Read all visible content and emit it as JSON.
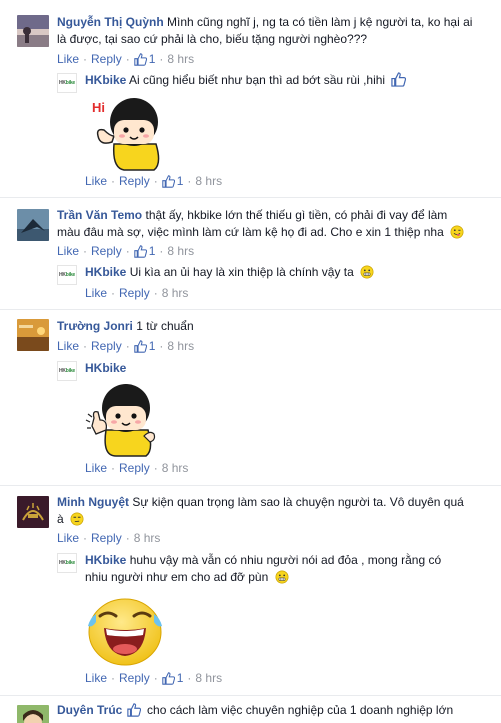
{
  "actions": {
    "like": "Like",
    "reply": "Reply",
    "sep": "·"
  },
  "comments": [
    {
      "author": "Nguyễn Thị Quỳnh",
      "text_line1": "Mình cũng nghĩ j, ng ta có tiền làm j kệ người ta, ko hại ai",
      "text_line2": "là được, tại sao cứ phải là cho, biếu tặng người nghèo???",
      "likes": "1",
      "time": "8 hrs",
      "reply": {
        "author": "HKbike",
        "text": "Ai cũng hiểu biết như bạn thì ad bớt sầu rùi ,hihi",
        "trailing_icon": "thumbs-up-icon",
        "sticker": "girl-hi-sticker",
        "sticker_text": "Hi",
        "likes": "1",
        "time": "8 hrs"
      }
    },
    {
      "author": "Trần Văn Temo",
      "text_line1": "thật ấy, hkbike lớn thế thiếu gì tiền, có phải đi vay để làm",
      "text_line2": "màu đâu mà sợ, việc mình làm cứ làm kệ họ đi ad. Cho e xin 1 thiệp nha",
      "likes": "1",
      "time": "8 hrs",
      "reply": {
        "author": "HKbike",
        "text": "Ui kìa an ủi hay là xin thiệp là chính vậy ta",
        "trailing_icon": "grimace-emoji-icon",
        "time": "8 hrs"
      }
    },
    {
      "author": "Trường Jonri",
      "text_line1": "1 từ chuẩn",
      "likes": "1",
      "time": "8 hrs",
      "reply": {
        "author": "HKbike",
        "sticker": "girl-thumbs-up-sticker",
        "time": "8 hrs"
      }
    },
    {
      "author": "Minh Nguyệt",
      "text_line1": "Sự kiện quan trọng làm sao là chuyện người ta. Vô duyên quá",
      "text_line2": "à",
      "time": "8 hrs",
      "reply": {
        "author": "HKbike",
        "text_line1": "huhu vậy mà vẫn có nhiu người nói ad đỏa , mong rằng có",
        "text_line2": "nhiu người như em cho ad đỡ pùn",
        "sticker": "laughing-crying-face-sticker",
        "likes": "1",
        "time": "8 hrs"
      }
    },
    {
      "author": "Duyên Trúc",
      "text_line1": "cho cách làm việc chuyên nghiệp của 1 doanh nghiệp lớn"
    }
  ],
  "colors": {
    "link": "#365899",
    "action_link": "#4267b2",
    "meta": "#90949c",
    "sticker_yellow": "#f7d51e",
    "divider": "#e9ebee"
  }
}
